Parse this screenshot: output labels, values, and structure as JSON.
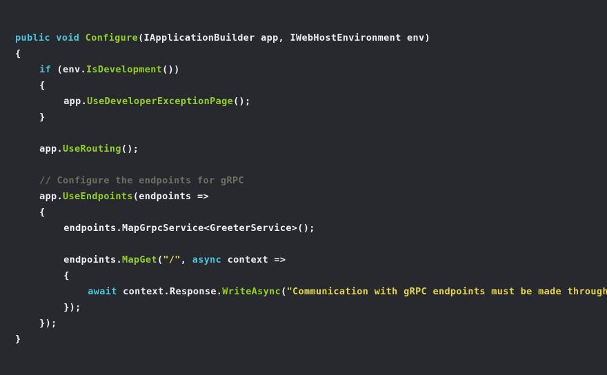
{
  "editor": {
    "background": "#27292e",
    "language": "csharp",
    "colors": {
      "keyword": "#4fc3d9",
      "method": "#94cf2a",
      "string": "#e6d44f",
      "comment": "#6e6f60",
      "plain": "#eceff1"
    },
    "lines": [
      {
        "indent": 0,
        "tokens": [
          {
            "text": "public",
            "type": "keyword"
          },
          {
            "text": " ",
            "type": "plain"
          },
          {
            "text": "void",
            "type": "keyword"
          },
          {
            "text": " ",
            "type": "plain"
          },
          {
            "text": "Configure",
            "type": "method"
          },
          {
            "text": "(IApplicationBuilder app, IWebHostEnvironment env)",
            "type": "plain"
          }
        ]
      },
      {
        "indent": 0,
        "tokens": [
          {
            "text": "{",
            "type": "plain"
          }
        ]
      },
      {
        "indent": 1,
        "tokens": [
          {
            "text": "if",
            "type": "keyword"
          },
          {
            "text": " (env.",
            "type": "plain"
          },
          {
            "text": "IsDevelopment",
            "type": "method"
          },
          {
            "text": "())",
            "type": "plain"
          }
        ]
      },
      {
        "indent": 1,
        "tokens": [
          {
            "text": "{",
            "type": "plain"
          }
        ]
      },
      {
        "indent": 2,
        "tokens": [
          {
            "text": "app.",
            "type": "plain"
          },
          {
            "text": "UseDeveloperExceptionPage",
            "type": "method"
          },
          {
            "text": "();",
            "type": "plain"
          }
        ]
      },
      {
        "indent": 1,
        "tokens": [
          {
            "text": "}",
            "type": "plain"
          }
        ]
      },
      {
        "indent": 0,
        "tokens": []
      },
      {
        "indent": 1,
        "tokens": [
          {
            "text": "app.",
            "type": "plain"
          },
          {
            "text": "UseRouting",
            "type": "method"
          },
          {
            "text": "();",
            "type": "plain"
          }
        ]
      },
      {
        "indent": 0,
        "tokens": []
      },
      {
        "indent": 1,
        "tokens": [
          {
            "text": "// Configure the endpoints for gRPC",
            "type": "comment"
          }
        ]
      },
      {
        "indent": 1,
        "tokens": [
          {
            "text": "app.",
            "type": "plain"
          },
          {
            "text": "UseEndpoints",
            "type": "method"
          },
          {
            "text": "(endpoints =>",
            "type": "plain"
          }
        ]
      },
      {
        "indent": 1,
        "tokens": [
          {
            "text": "{",
            "type": "plain"
          }
        ]
      },
      {
        "indent": 2,
        "tokens": [
          {
            "text": "endpoints.MapGrpcService<GreeterService>();",
            "type": "plain"
          }
        ]
      },
      {
        "indent": 0,
        "tokens": []
      },
      {
        "indent": 2,
        "tokens": [
          {
            "text": "endpoints.",
            "type": "plain"
          },
          {
            "text": "MapGet",
            "type": "method"
          },
          {
            "text": "(",
            "type": "plain"
          },
          {
            "text": "\"/\"",
            "type": "string"
          },
          {
            "text": ", ",
            "type": "plain"
          },
          {
            "text": "async",
            "type": "keyword"
          },
          {
            "text": " context =>",
            "type": "plain"
          }
        ]
      },
      {
        "indent": 2,
        "tokens": [
          {
            "text": "{",
            "type": "plain"
          }
        ]
      },
      {
        "indent": 3,
        "tokens": [
          {
            "text": "await",
            "type": "keyword"
          },
          {
            "text": " context.Response.",
            "type": "plain"
          },
          {
            "text": "WriteAsync",
            "type": "method"
          },
          {
            "text": "(",
            "type": "plain"
          },
          {
            "text": "\"Communication with gRPC endpoints must be made through a gRPC client.\");",
            "type": "string"
          }
        ]
      },
      {
        "indent": 2,
        "tokens": [
          {
            "text": "});",
            "type": "plain"
          }
        ]
      },
      {
        "indent": 1,
        "tokens": [
          {
            "text": "});",
            "type": "plain"
          }
        ]
      },
      {
        "indent": 0,
        "tokens": [
          {
            "text": "}",
            "type": "plain"
          }
        ]
      }
    ]
  }
}
